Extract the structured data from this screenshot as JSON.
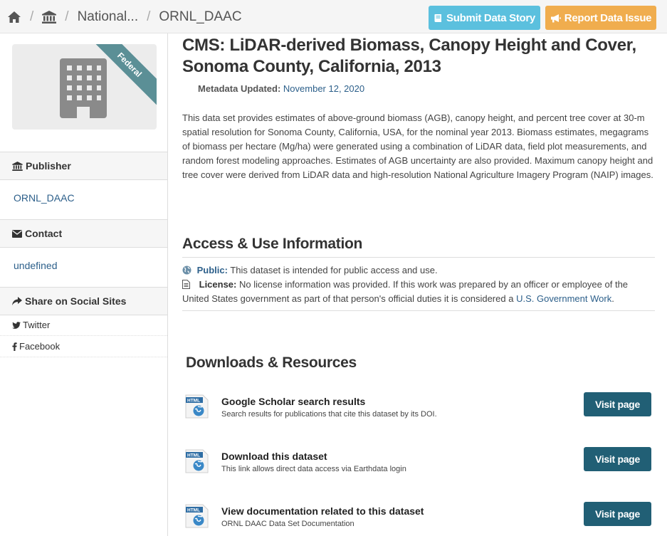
{
  "breadcrumb": {
    "items": [
      "National...",
      "ORNL_DAAC"
    ]
  },
  "actions": {
    "submit_story": "Submit Data Story",
    "report_issue": "Report Data Issue"
  },
  "colors": {
    "info": "#5bc0de",
    "warning": "#f0ad4e",
    "primary_dark": "#215f75",
    "link": "#2c5f8a",
    "ribbon": "#5b8f96"
  },
  "sidebar": {
    "badge": "Federal",
    "publisher": {
      "heading": "Publisher",
      "value": "ORNL_DAAC"
    },
    "contact": {
      "heading": "Contact",
      "value": "undefined"
    },
    "share": {
      "heading": "Share on Social Sites",
      "twitter": "Twitter",
      "facebook": "Facebook"
    }
  },
  "dataset": {
    "title": "CMS: LiDAR-derived Biomass, Canopy Height and Cover, Sonoma County, California, 2013",
    "metadata_label": "Metadata Updated:",
    "metadata_value": "November 12, 2020",
    "description": "This data set provides estimates of above-ground biomass (AGB), canopy height, and percent tree cover at 30-m spatial resolution for Sonoma County, California, USA, for the nominal year 2013. Biomass estimates, megagrams of biomass per hectare (Mg/ha) were generated using a combination of LiDAR data, field plot measurements, and random forest modeling approaches. Estimates of AGB uncertainty are also provided. Maximum canopy height and tree cover were derived from LiDAR data and high-resolution National Agriculture Imagery Program (NAIP) images."
  },
  "access": {
    "heading": "Access & Use Information",
    "public_label": "Public:",
    "public_text": "This dataset is intended for public access and use.",
    "license_label": "License:",
    "license_text": "No license information was provided. If this work was prepared by an officer or employee of the United States government as part of that person's official duties it is considered a",
    "license_link": "U.S. Government Work",
    "license_end": "."
  },
  "resources": {
    "heading": "Downloads & Resources",
    "button_label": "Visit page",
    "icon_label": "HTML",
    "items": [
      {
        "title": "Google Scholar search results",
        "desc": "Search results for publications that cite this dataset by its DOI."
      },
      {
        "title": "Download this dataset",
        "desc": "This link allows direct data access via Earthdata login"
      },
      {
        "title": "View documentation related to this dataset",
        "desc": "ORNL DAAC Data Set Documentation"
      }
    ]
  }
}
